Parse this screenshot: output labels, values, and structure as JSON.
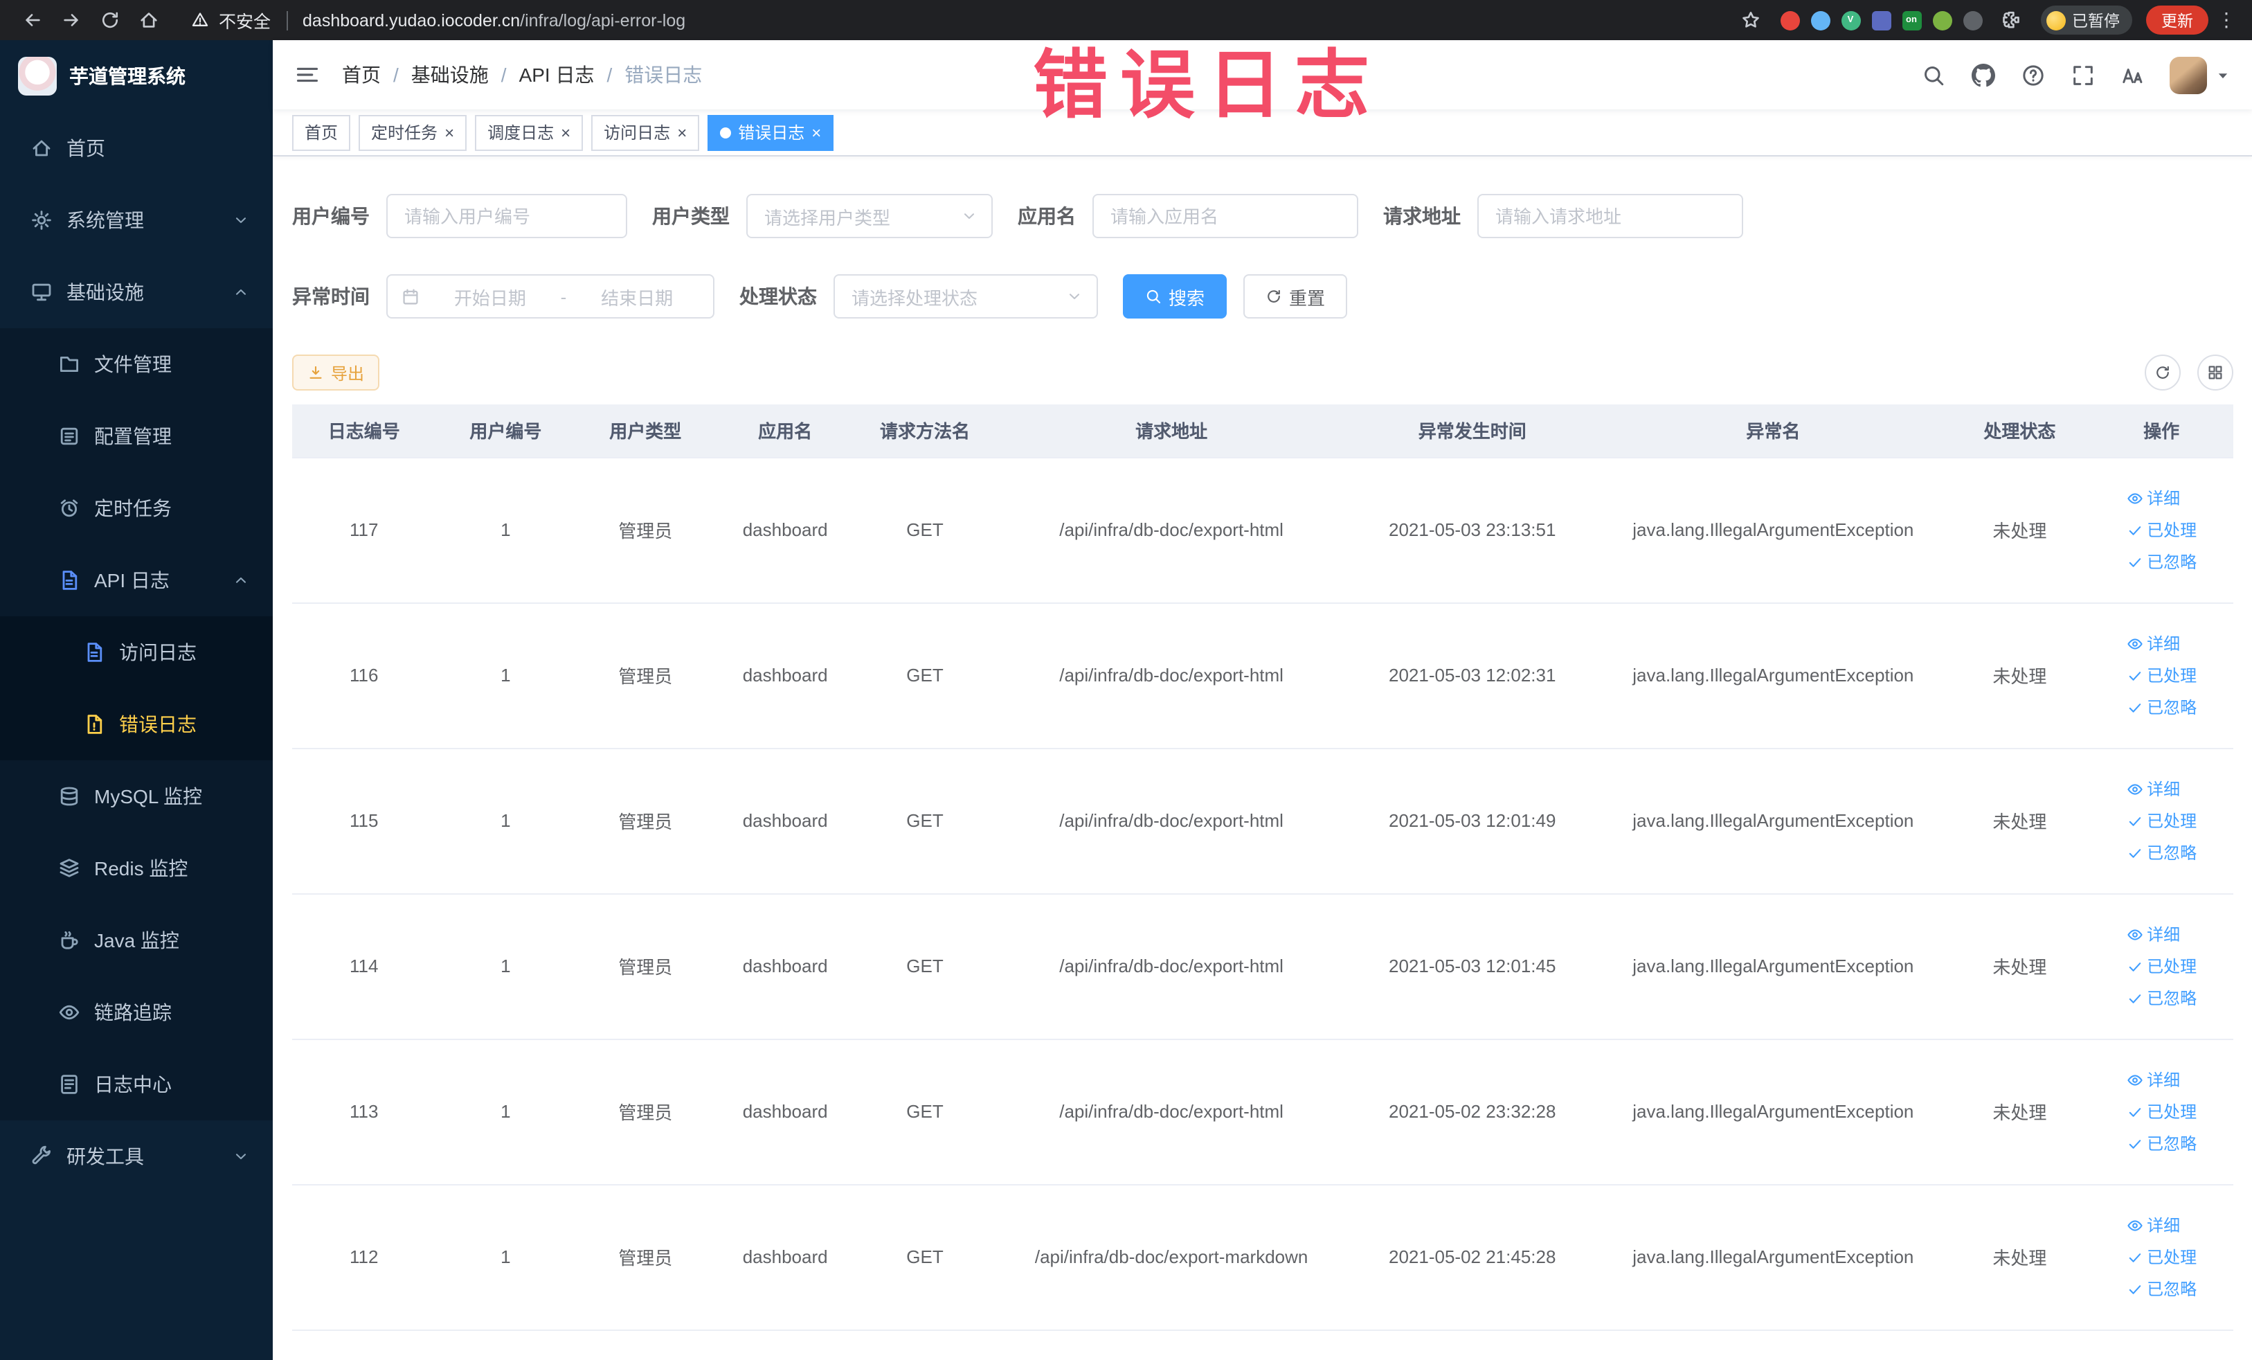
{
  "annotation": {
    "overlay_text": "错误日志"
  },
  "browser": {
    "security_label": "不安全",
    "url_domain": "dashboard.yudao.iocoder.cn",
    "url_path": "/infra/log/api-error-log",
    "paused_badge": "已暂停",
    "update_button": "更新",
    "extensions": [
      {
        "name": "adblock-extension-icon",
        "color": "#e8453c",
        "glyph": "",
        "shape": "circle"
      },
      {
        "name": "eyedropper-extension-icon",
        "color": "#64b5f6",
        "glyph": "",
        "shape": "circle"
      },
      {
        "name": "vue-devtools-extension-icon",
        "color": "#41b883",
        "glyph": "V",
        "shape": "circle"
      },
      {
        "name": "apps-grid-extension-icon",
        "color": "#5c6bc0",
        "glyph": "",
        "shape": "square"
      },
      {
        "name": "switch-on-extension-icon",
        "color": "#1e8e3e",
        "glyph": "on",
        "shape": "square"
      },
      {
        "name": "leaf-extension-icon",
        "color": "#7cb342",
        "glyph": "",
        "shape": "circle"
      },
      {
        "name": "paw-extension-icon",
        "color": "#5f6368",
        "glyph": "",
        "shape": "circle"
      }
    ]
  },
  "sidebar": {
    "app_title": "芋道管理系统",
    "items": [
      {
        "key": "home",
        "label": "首页",
        "icon": "home-icon",
        "level": 0
      },
      {
        "key": "system",
        "label": "系统管理",
        "icon": "gear-icon",
        "level": 0,
        "expandable": true,
        "expanded": false
      },
      {
        "key": "infra",
        "label": "基础设施",
        "icon": "infra-icon",
        "level": 0,
        "expandable": true,
        "expanded": true
      },
      {
        "key": "file",
        "label": "文件管理",
        "icon": "file-icon",
        "level": 1
      },
      {
        "key": "config",
        "label": "配置管理",
        "icon": "config-icon",
        "level": 1
      },
      {
        "key": "job",
        "label": "定时任务",
        "icon": "job-icon",
        "level": 1
      },
      {
        "key": "api-log",
        "label": "API 日志",
        "icon": "api-log-icon",
        "level": 1,
        "expandable": true,
        "expanded": true,
        "icon_color": "#5b8ff9"
      },
      {
        "key": "api-access-log",
        "label": "访问日志",
        "icon": "access-log-icon",
        "level": 2,
        "icon_color": "#5b8ff9"
      },
      {
        "key": "api-error-log",
        "label": "错误日志",
        "icon": "error-log-icon",
        "level": 2,
        "active": true
      },
      {
        "key": "mysql",
        "label": "MySQL 监控",
        "icon": "mysql-icon",
        "level": 1
      },
      {
        "key": "redis",
        "label": "Redis 监控",
        "icon": "redis-icon",
        "level": 1
      },
      {
        "key": "java",
        "label": "Java 监控",
        "icon": "java-icon",
        "level": 1
      },
      {
        "key": "trace",
        "label": "链路追踪",
        "icon": "trace-icon",
        "level": 1
      },
      {
        "key": "log-center",
        "label": "日志中心",
        "icon": "log-center-icon",
        "level": 1
      },
      {
        "key": "dev-tools",
        "label": "研发工具",
        "icon": "tools-icon",
        "level": 0,
        "expandable": true,
        "expanded": false
      }
    ]
  },
  "header": {
    "breadcrumbs": [
      "首页",
      "基础设施",
      "API 日志",
      "错误日志"
    ],
    "separator": "/"
  },
  "tabs": [
    {
      "key": "home",
      "label": "首页",
      "closable": false,
      "active": false
    },
    {
      "key": "job",
      "label": "定时任务",
      "closable": true,
      "active": false
    },
    {
      "key": "job-log",
      "label": "调度日志",
      "closable": true,
      "active": false
    },
    {
      "key": "api-access-log",
      "label": "访问日志",
      "closable": true,
      "active": false
    },
    {
      "key": "api-error-log",
      "label": "错误日志",
      "closable": true,
      "active": true
    }
  ],
  "filters": {
    "user_id": {
      "label": "用户编号",
      "placeholder": "请输入用户编号"
    },
    "user_type": {
      "label": "用户类型",
      "placeholder": "请选择用户类型"
    },
    "app_name": {
      "label": "应用名",
      "placeholder": "请输入应用名"
    },
    "request_url": {
      "label": "请求地址",
      "placeholder": "请输入请求地址"
    },
    "exception_time": {
      "label": "异常时间",
      "start_placeholder": "开始日期",
      "end_placeholder": "结束日期",
      "range_separator": "-"
    },
    "process_status": {
      "label": "处理状态",
      "placeholder": "请选择处理状态"
    },
    "search_button": "搜索",
    "reset_button": "重置"
  },
  "toolbar": {
    "export_button": "导出"
  },
  "table": {
    "columns": [
      "日志编号",
      "用户编号",
      "用户类型",
      "应用名",
      "请求方法名",
      "请求地址",
      "异常发生时间",
      "异常名",
      "处理状态",
      "操作"
    ],
    "row_actions": [
      "详细",
      "已处理",
      "已忽略"
    ],
    "rows": [
      {
        "log_id": "117",
        "user_id": "1",
        "user_type": "管理员",
        "app_name": "dashboard",
        "method": "GET",
        "url": "/api/infra/db-doc/export-html",
        "time": "2021-05-03 23:13:51",
        "exception": "java.lang.IllegalArgumentException",
        "status": "未处理"
      },
      {
        "log_id": "116",
        "user_id": "1",
        "user_type": "管理员",
        "app_name": "dashboard",
        "method": "GET",
        "url": "/api/infra/db-doc/export-html",
        "time": "2021-05-03 12:02:31",
        "exception": "java.lang.IllegalArgumentException",
        "status": "未处理"
      },
      {
        "log_id": "115",
        "user_id": "1",
        "user_type": "管理员",
        "app_name": "dashboard",
        "method": "GET",
        "url": "/api/infra/db-doc/export-html",
        "time": "2021-05-03 12:01:49",
        "exception": "java.lang.IllegalArgumentException",
        "status": "未处理"
      },
      {
        "log_id": "114",
        "user_id": "1",
        "user_type": "管理员",
        "app_name": "dashboard",
        "method": "GET",
        "url": "/api/infra/db-doc/export-html",
        "time": "2021-05-03 12:01:45",
        "exception": "java.lang.IllegalArgumentException",
        "status": "未处理"
      },
      {
        "log_id": "113",
        "user_id": "1",
        "user_type": "管理员",
        "app_name": "dashboard",
        "method": "GET",
        "url": "/api/infra/db-doc/export-html",
        "time": "2021-05-02 23:32:28",
        "exception": "java.lang.IllegalArgumentException",
        "status": "未处理"
      },
      {
        "log_id": "112",
        "user_id": "1",
        "user_type": "管理员",
        "app_name": "dashboard",
        "method": "GET",
        "url": "/api/infra/db-doc/export-markdown",
        "time": "2021-05-02 21:45:28",
        "exception": "java.lang.IllegalArgumentException",
        "status": "未处理"
      }
    ]
  },
  "colors": {
    "accent": "#409eff",
    "chrome_bg": "#202124",
    "update_button_bg": "#d93a2b",
    "sidebar_bg": "#0c2135",
    "sidebar_submenu_bg": "#091a2b",
    "sidebar_deep_bg": "#051321",
    "sidebar_text": "#bfcbd9",
    "sidebar_active_text": "#ffd04b",
    "annotation_color": "#f23e5c",
    "warning_text": "#e6a23c",
    "warning_bg": "#fdf6ec",
    "warning_border": "#f5dab1",
    "table_header_bg": "#eef1f6",
    "border": "#ebeef5",
    "text_primary": "#303133",
    "text_regular": "#606266",
    "placeholder": "#c0c4cc"
  }
}
